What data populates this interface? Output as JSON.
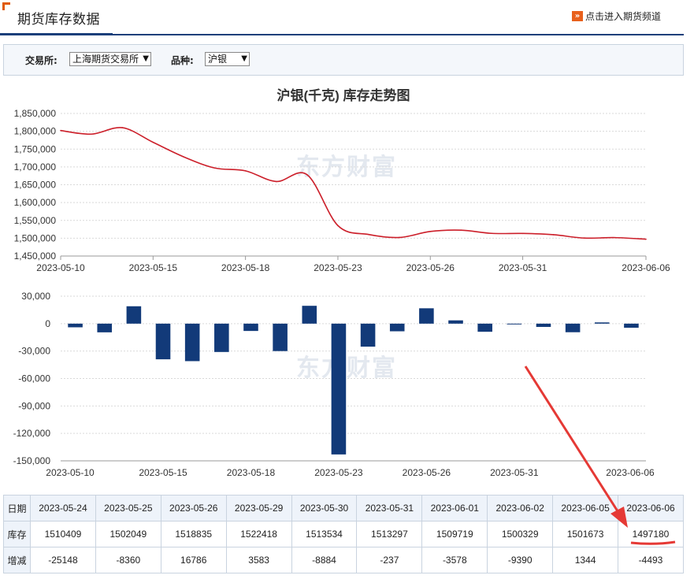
{
  "header": {
    "title": "期货库存数据",
    "link_label": "点击进入期货频道"
  },
  "filter": {
    "exchange_label": "交易所:",
    "exchange_value": "上海期货交易所",
    "variety_label": "品种:",
    "variety_value": "沪银"
  },
  "watermark": "东方财富",
  "colors": {
    "line": "#cc1f2a",
    "bar": "#123a79",
    "accent": "#e05a00",
    "annotation": "#e53935"
  },
  "chart_data": [
    {
      "type": "line",
      "title": "沪银(千克) 库存走势图",
      "x": [
        "2023-05-10",
        "2023-05-11",
        "2023-05-12",
        "2023-05-15",
        "2023-05-16",
        "2023-05-17",
        "2023-05-18",
        "2023-05-19",
        "2023-05-22",
        "2023-05-23",
        "2023-05-24",
        "2023-05-25",
        "2023-05-26",
        "2023-05-29",
        "2023-05-30",
        "2023-05-31",
        "2023-06-01",
        "2023-06-02",
        "2023-06-05",
        "2023-06-06"
      ],
      "values": [
        1802000,
        1792000,
        1810000,
        1769000,
        1728000,
        1697000,
        1689000,
        1659000,
        1678000,
        1535380,
        1510409,
        1502049,
        1518835,
        1522418,
        1513534,
        1513297,
        1509719,
        1500329,
        1501673,
        1497180
      ],
      "xticks": [
        "2023-05-10",
        "2023-05-15",
        "2023-05-18",
        "2023-05-23",
        "2023-05-26",
        "2023-05-31",
        "2023-06-06"
      ],
      "ylim": [
        1450000,
        1850000
      ],
      "yticks": [
        "1,850,000",
        "1,800,000",
        "1,750,000",
        "1,700,000",
        "1,650,000",
        "1,600,000",
        "1,550,000",
        "1,500,000",
        "1,450,000"
      ],
      "grid": true
    },
    {
      "type": "bar",
      "x": [
        "2023-05-10",
        "2023-05-11",
        "2023-05-12",
        "2023-05-15",
        "2023-05-16",
        "2023-05-17",
        "2023-05-18",
        "2023-05-19",
        "2023-05-22",
        "2023-05-23",
        "2023-05-24",
        "2023-05-25",
        "2023-05-26",
        "2023-05-29",
        "2023-05-30",
        "2023-05-31",
        "2023-06-01",
        "2023-06-02",
        "2023-06-05",
        "2023-06-06"
      ],
      "values": [
        -4000,
        -9500,
        19000,
        -39000,
        -41000,
        -31000,
        -8000,
        -30000,
        19500,
        -143000,
        -25148,
        -8360,
        16786,
        3583,
        -8884,
        -237,
        -3578,
        -9390,
        1344,
        -4493
      ],
      "xticks": [
        "2023-05-10",
        "2023-05-15",
        "2023-05-18",
        "2023-05-23",
        "2023-05-26",
        "2023-05-31",
        "2023-06-06"
      ],
      "ylim": [
        -150000,
        30000
      ],
      "yticks": [
        "30,000",
        "0",
        "-30,000",
        "-60,000",
        "-90,000",
        "-120,000",
        "-150,000"
      ],
      "grid": true
    }
  ],
  "table": {
    "row_headers": [
      "日期",
      "库存",
      "增减"
    ],
    "dates": [
      "2023-05-24",
      "2023-05-25",
      "2023-05-26",
      "2023-05-29",
      "2023-05-30",
      "2023-05-31",
      "2023-06-01",
      "2023-06-02",
      "2023-06-05",
      "2023-06-06"
    ],
    "stock": [
      "1510409",
      "1502049",
      "1518835",
      "1522418",
      "1513534",
      "1513297",
      "1509719",
      "1500329",
      "1501673",
      "1497180"
    ],
    "change": [
      "-25148",
      "-8360",
      "16786",
      "3583",
      "-8884",
      "-237",
      "-3578",
      "-9390",
      "1344",
      "-4493"
    ]
  }
}
